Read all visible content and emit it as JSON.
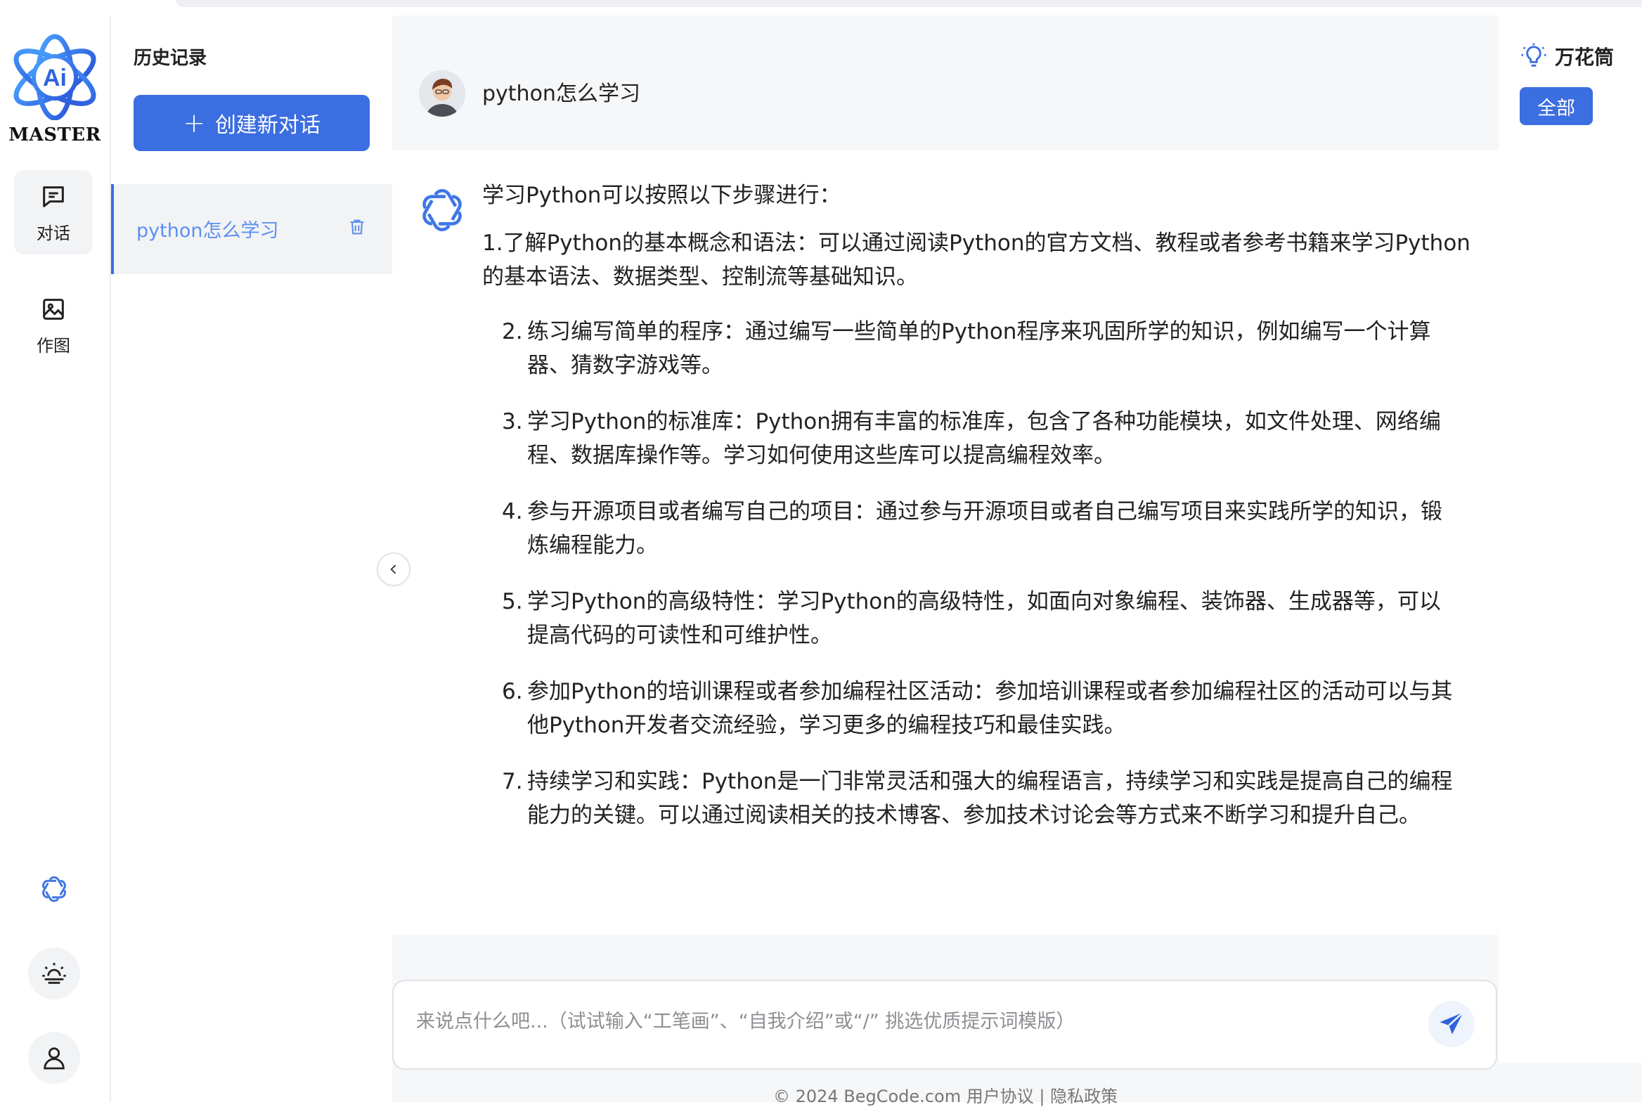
{
  "brand": {
    "logo_text": "MASTER",
    "logo_glyph": "Ai",
    "accent": "#3b6ee0"
  },
  "nav": {
    "items": [
      {
        "label": "对话",
        "icon": "chat-icon"
      },
      {
        "label": "作图",
        "icon": "image-icon"
      }
    ],
    "bottom_buttons": [
      {
        "icon": "openai-logo-icon"
      },
      {
        "icon": "sun-theme-icon"
      },
      {
        "icon": "user-icon"
      }
    ]
  },
  "history": {
    "title": "历史记录",
    "new_chat_label": "创建新对话",
    "items": [
      {
        "label": "python怎么学习",
        "delete_icon": "trash-icon"
      }
    ]
  },
  "chat": {
    "question": "python怎么学习",
    "answer": {
      "intro": "学习Python可以按照以下步骤进行：",
      "para": "1.了解Python的基本概念和语法：可以通过阅读Python的官方文档、教程或者参考书籍来学习Python的基本语法、数据类型、控制流等基础知识。",
      "items": [
        {
          "num": "2.",
          "text": "练习编写简单的程序：通过编写一些简单的Python程序来巩固所学的知识，例如编写一个计算器、猜数字游戏等。"
        },
        {
          "num": "3.",
          "text": "学习Python的标准库：Python拥有丰富的标准库，包含了各种功能模块，如文件处理、网络编程、数据库操作等。学习如何使用这些库可以提高编程效率。"
        },
        {
          "num": "4.",
          "text": "参与开源项目或者编写自己的项目：通过参与开源项目或者自己编写项目来实践所学的知识，锻炼编程能力。"
        },
        {
          "num": "5.",
          "text": "学习Python的高级特性：学习Python的高级特性，如面向对象编程、装饰器、生成器等，可以提高代码的可读性和可维护性。"
        },
        {
          "num": "6.",
          "text": "参加Python的培训课程或者参加编程社区活动：参加培训课程或者参加编程社区的活动可以与其他Python开发者交流经验，学习更多的编程技巧和最佳实践。"
        },
        {
          "num": "7.",
          "text": "持续学习和实践：Python是一门非常灵活和强大的编程语言，持续学习和实践是提高自己的编程能力的关键。可以通过阅读相关的技术博客、参加技术讨论会等方式来不断学习和提升自己。"
        }
      ]
    },
    "input_placeholder": "来说点什么吧...（试试输入“工笔画”、“自我介绍”或“/” 挑选优质提示词模版）",
    "footer": "© 2024 BegCode.com 用户协议 | 隐私政策"
  },
  "right_panel": {
    "title": "万花筒",
    "filter_label": "全部",
    "icon": "lightbulb-icon"
  }
}
